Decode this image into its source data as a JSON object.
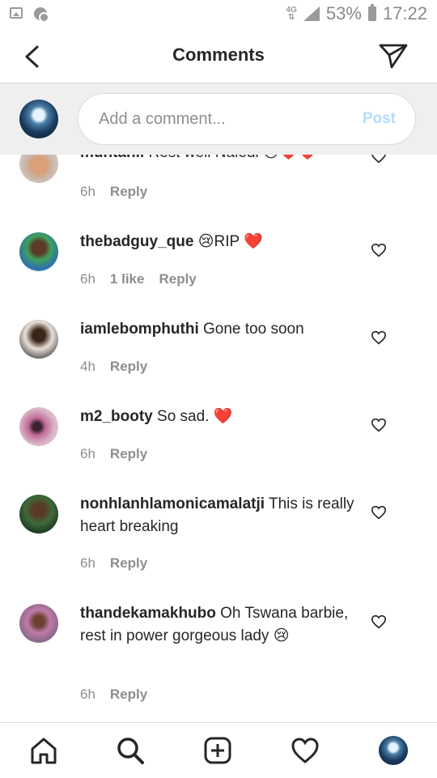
{
  "status_bar": {
    "network": "4G",
    "battery": "53%",
    "time": "17:22"
  },
  "header": {
    "title": "Comments"
  },
  "composer": {
    "placeholder": "Add a comment...",
    "post_label": "Post"
  },
  "comments": [
    {
      "username": "muntanii",
      "text": "Rest well Naledi 😢❤️❤️",
      "time": "6h",
      "likes": "",
      "reply": "Reply"
    },
    {
      "username": "thebadguy_que",
      "text": "😢RIP ❤️",
      "time": "6h",
      "likes": "1 like",
      "reply": "Reply"
    },
    {
      "username": "iamlebomphuthi",
      "text": "Gone too soon",
      "time": "4h",
      "likes": "",
      "reply": "Reply"
    },
    {
      "username": "m2_booty",
      "text": "So sad. ❤️",
      "time": "6h",
      "likes": "",
      "reply": "Reply"
    },
    {
      "username": "nonhlanhlamonicamalatji",
      "text": "This is really heart breaking",
      "time": "6h",
      "likes": "",
      "reply": "Reply"
    },
    {
      "username": "thandekamakhubo",
      "text": "Oh Tswana barbie, rest in power gorgeous lady 😢",
      "time": "6h",
      "likes": "",
      "reply": "Reply"
    }
  ],
  "nav": {
    "items": [
      "home-icon",
      "search-icon",
      "add-post-icon",
      "activity-heart-icon",
      "profile-avatar"
    ]
  }
}
